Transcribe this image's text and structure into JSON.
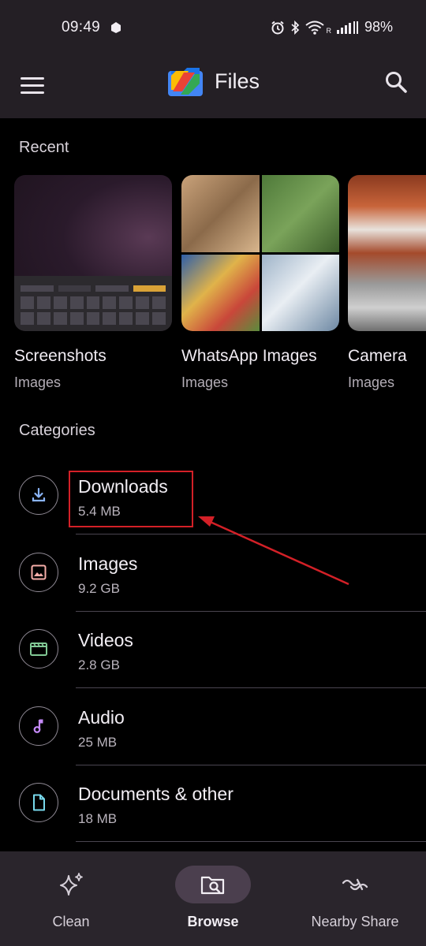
{
  "status_bar": {
    "time": "09:49",
    "signal_label": "R",
    "battery": "98%",
    "icons": [
      "notification-icon",
      "alarm-icon",
      "bluetooth-icon",
      "wifi-icon",
      "cellular-signal-icon"
    ]
  },
  "app_bar": {
    "title": "Files",
    "icons": [
      "menu-icon",
      "files-logo",
      "search-icon"
    ]
  },
  "recent": {
    "title": "Recent",
    "items": [
      {
        "name": "Screenshots",
        "type": "Images"
      },
      {
        "name": "WhatsApp Images",
        "type": "Images"
      },
      {
        "name": "Camera",
        "type": "Images"
      }
    ]
  },
  "categories": {
    "title": "Categories",
    "items": [
      {
        "name": "Downloads",
        "size": "5.4 MB",
        "icon": "download-icon",
        "color": "#8ab4f8"
      },
      {
        "name": "Images",
        "size": "9.2 GB",
        "icon": "image-icon",
        "color": "#f6aea9"
      },
      {
        "name": "Videos",
        "size": "2.8 GB",
        "icon": "video-icon",
        "color": "#81c995"
      },
      {
        "name": "Audio",
        "size": "25 MB",
        "icon": "music-note-icon",
        "color": "#c58af9"
      },
      {
        "name": "Documents & other",
        "size": "18 MB",
        "icon": "document-icon",
        "color": "#78d9ec"
      }
    ]
  },
  "bottom_nav": {
    "items": [
      {
        "label": "Clean",
        "icon": "sparkle-icon",
        "active": false
      },
      {
        "label": "Browse",
        "icon": "browse-folder-icon",
        "active": true
      },
      {
        "label": "Nearby Share",
        "icon": "nearby-share-icon",
        "active": false
      }
    ]
  },
  "colors": {
    "background": "#000000",
    "bar_background": "#241f25",
    "annotation_red": "#d32027",
    "active_pill": "#4b3f4e"
  }
}
